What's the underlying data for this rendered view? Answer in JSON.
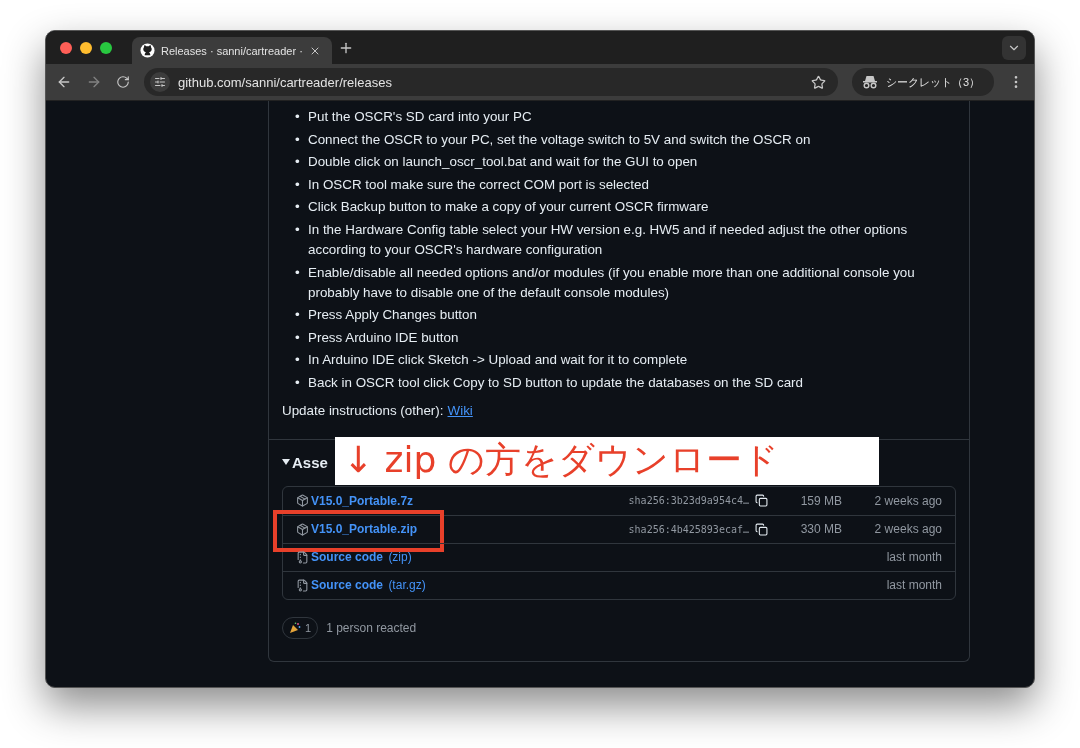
{
  "browser": {
    "tabs": [
      {
        "title": "Releases · sanni/cartreader ·",
        "selected": true
      }
    ],
    "url": "github.com/sanni/cartreader/releases",
    "profile": "シークレット（3）"
  },
  "release": {
    "bullet": "•",
    "steps": [
      "Put the OSCR's SD card into your PC",
      "Connect the OSCR to your PC, set the voltage switch to 5V and switch the OSCR on",
      "Double click on launch_oscr_tool.bat and wait for the GUI to open",
      "In OSCR tool make sure the correct COM port is selected",
      "Click Backup button to make a copy of your current OSCR firmware",
      "In the Hardware Config table select your HW version e.g. HW5 and if needed adjust the other options according to your OSCR's hardware configuration",
      "Enable/disable all needed options and/or modules (if you enable more than one additional console you probably have to disable one of the default console modules)",
      "Press Apply Changes button",
      "Press Arduino IDE button",
      "In Arduino IDE click Sketch -> Upload and wait for it to complete",
      "Back in OSCR tool click Copy to SD button to update the databases on the SD card"
    ],
    "update_note": {
      "text": "Update instructions (other):",
      "link": "Wiki"
    },
    "assets": {
      "heading": "Asse",
      "expanded": true,
      "rows": [
        {
          "kind": "package",
          "name": "V15.0_Portable.7z",
          "sha": "sha256:3b23d9a954c4…",
          "size": "159 MB",
          "date": "2 weeks ago",
          "highlighted": false
        },
        {
          "kind": "package",
          "name": "V15.0_Portable.zip",
          "sha": "sha256:4b425893ecaf…",
          "size": "330 MB",
          "date": "2 weeks ago",
          "highlighted": true
        },
        {
          "kind": "source",
          "name": "Source code",
          "ext": "(zip)",
          "date": "last month",
          "highlighted": false
        },
        {
          "kind": "source",
          "name": "Source code",
          "ext": "(tar.gz)",
          "date": "last month",
          "highlighted": false
        }
      ]
    },
    "reactions": {
      "count": "1",
      "text": "1 person reacted"
    }
  },
  "annotation": {
    "text": "↓ zip の方をダウンロード"
  }
}
